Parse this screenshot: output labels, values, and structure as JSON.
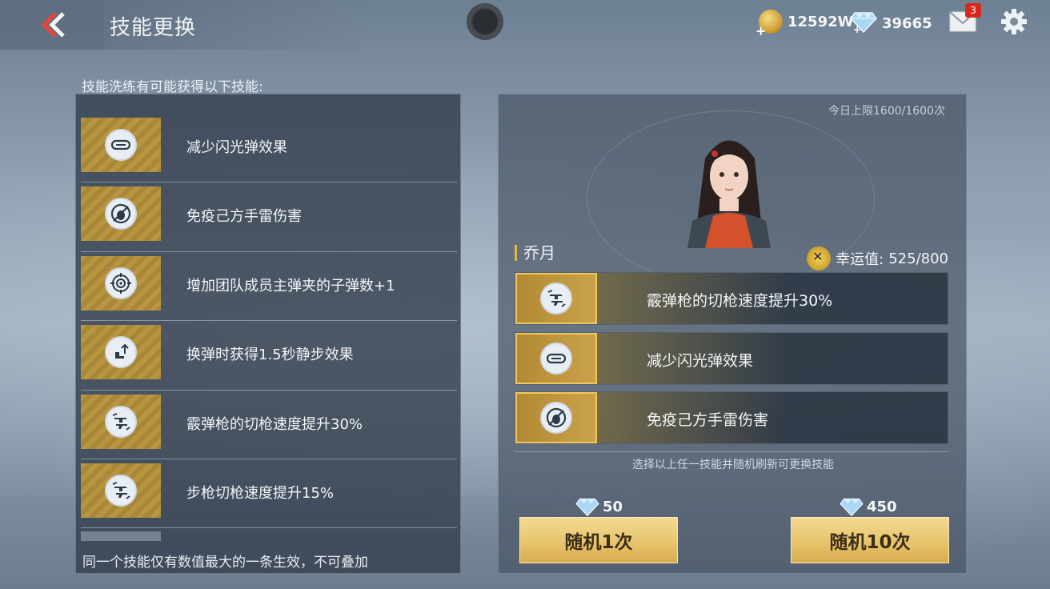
{
  "header": {
    "title": "技能更换",
    "gold": "12592W",
    "diamonds": "39665",
    "mail_badge": "3"
  },
  "left": {
    "heading": "技能洗练有可能获得以下技能:",
    "skills": [
      {
        "label": "减少闪光弹效果",
        "icon": "goggles-icon"
      },
      {
        "label": "免疫己方手雷伤害",
        "icon": "grenade-immune-icon"
      },
      {
        "label": "增加团队成员主弹夹的子弹数+1",
        "icon": "crosshair-icon"
      },
      {
        "label": "换弹时获得1.5秒静步效果",
        "icon": "silent-step-icon"
      },
      {
        "label": "霰弹枪的切枪速度提升30%",
        "icon": "weapon-swap-icon"
      },
      {
        "label": "步枪切枪速度提升15%",
        "icon": "weapon-swap-icon"
      }
    ],
    "footer": "同一个技能仅有数值最大的一条生效，不可叠加"
  },
  "right": {
    "daily_limit": "今日上限1600/1600次",
    "character_name": "乔月",
    "luck_label": "幸运值:",
    "luck_value": "525/800",
    "options": [
      {
        "label": "霰弹枪的切枪速度提升30%",
        "icon": "weapon-swap-icon"
      },
      {
        "label": "减少闪光弹效果",
        "icon": "goggles-icon"
      },
      {
        "label": "免疫己方手雷伤害",
        "icon": "grenade-immune-icon"
      }
    ],
    "hint": "选择以上任一技能并随机刷新可更换技能",
    "buttons": [
      {
        "label": "随机1次",
        "cost": "50"
      },
      {
        "label": "随机10次",
        "cost": "450"
      }
    ]
  },
  "colors": {
    "accent_gold": "#e8c46c",
    "badge_red": "#d8271f",
    "back_arrow": "#e5473a"
  }
}
